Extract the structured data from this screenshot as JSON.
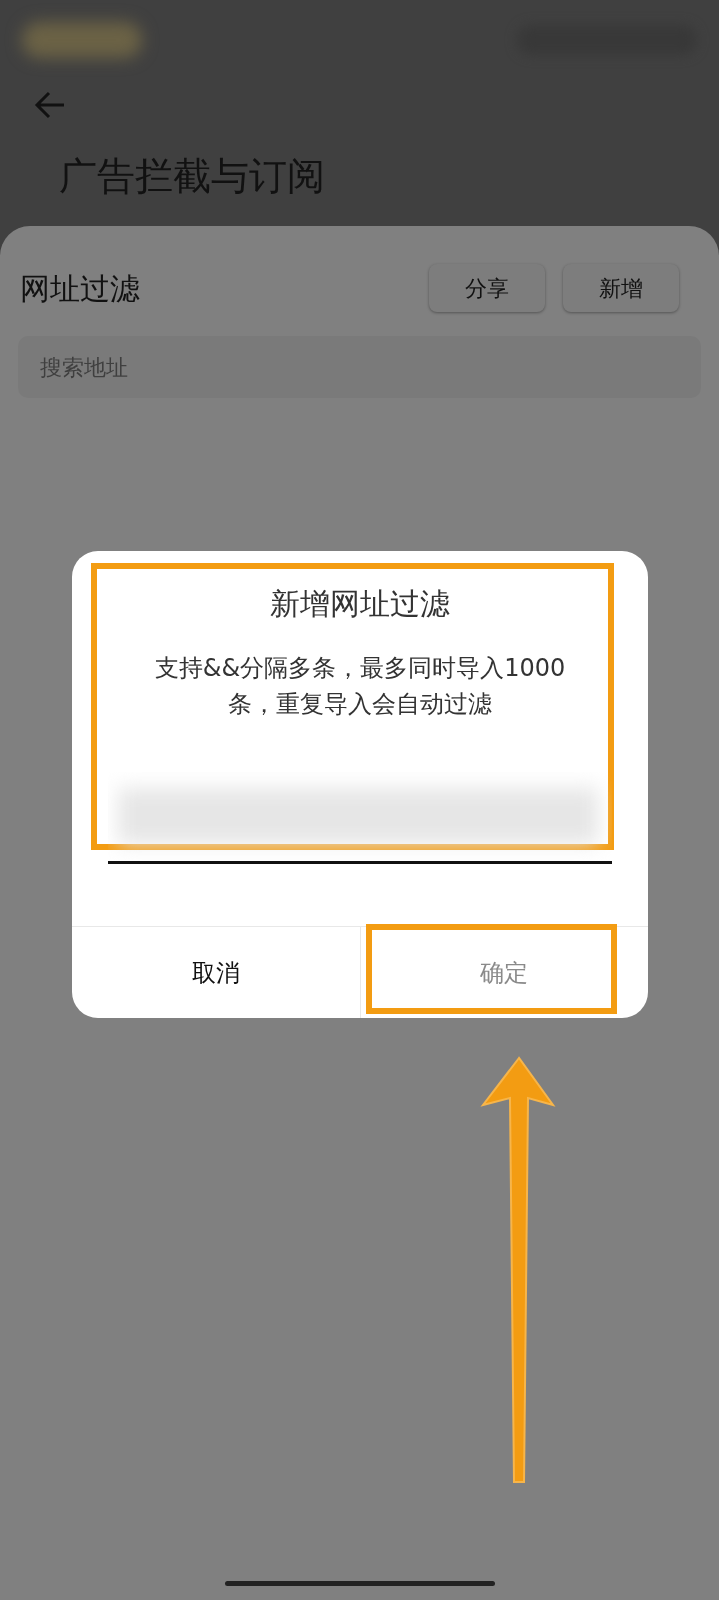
{
  "header": {
    "title": "广告拦截与订阅"
  },
  "sheet": {
    "title": "网址过滤",
    "buttons": [
      "分享",
      "新增"
    ],
    "search": {
      "placeholder": "搜索地址"
    }
  },
  "dialog": {
    "title": "新增网址过滤",
    "message": "支持&&分隔多条，最多同时导入1000条，重复导入会自动过滤",
    "buttons": [
      {
        "label": "取消",
        "disabled": false
      },
      {
        "label": "确定",
        "disabled": true
      }
    ]
  }
}
